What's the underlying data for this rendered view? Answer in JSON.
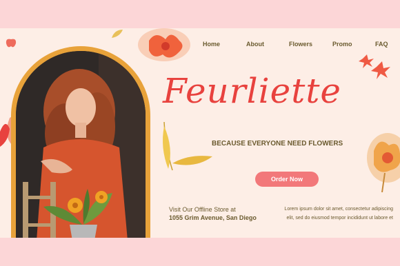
{
  "nav": {
    "items": [
      {
        "label": "Home"
      },
      {
        "label": "About"
      },
      {
        "label": "Flowers"
      },
      {
        "label": "Promo"
      },
      {
        "label": "FAQ"
      }
    ]
  },
  "hero": {
    "title": "Feurliette",
    "tagline": "BECAUSE EVERYONE NEED FLOWERS",
    "cta_label": "Order Now"
  },
  "store": {
    "visit_text": "Visit Our Offline Store at",
    "address": "1055 Grim Avenue, San Diego"
  },
  "blurb": {
    "line1": "Lorem ipsum dolor sit amet, consectetur adipiscing",
    "line2": "elit, sed do eiusmod tempor incididunt ut labore et"
  },
  "colors": {
    "page_background": "#fcd6d7",
    "panel_background": "#fdeee6",
    "title_color": "#e8423e",
    "text_color": "#6a5a2e",
    "button_color": "#f2787a",
    "arch_color": "#e8a23a"
  }
}
